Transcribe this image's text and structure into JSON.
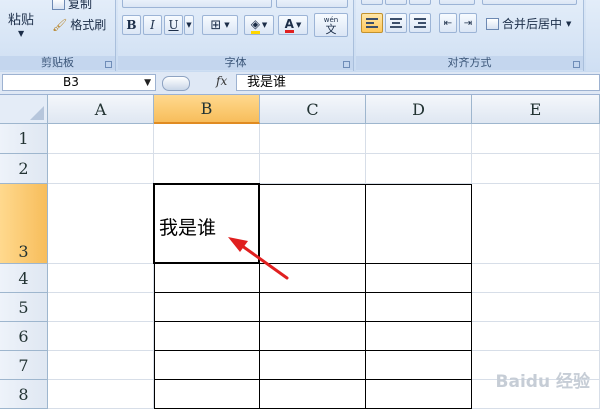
{
  "ribbon": {
    "clipboard": {
      "paste": "粘贴",
      "copy": "复制",
      "format_painter": "格式刷",
      "label": "剪贴板"
    },
    "font": {
      "bold": "B",
      "italic": "I",
      "underline": "U",
      "font_color": "A",
      "phonetic": "wén",
      "phonetic_char": "文",
      "label": "字体"
    },
    "alignment": {
      "merge_center": "合并后居中",
      "label": "对齐方式"
    }
  },
  "formula_bar": {
    "name_box": "B3",
    "fx": "fx",
    "content": "我是谁"
  },
  "columns": [
    "A",
    "B",
    "C",
    "D",
    "E"
  ],
  "rows": [
    "1",
    "2",
    "3",
    "4",
    "5",
    "6",
    "7",
    "8"
  ],
  "selected": {
    "column": "B",
    "row": "3"
  },
  "cells": {
    "B3": "我是谁"
  },
  "annotation": {
    "arrow_color": "#e02020"
  },
  "watermark": "Baidu 经验",
  "colors": {
    "selected_header": "#f7bd5b",
    "ribbon": "#cfdff3",
    "border_color": "#000000"
  }
}
